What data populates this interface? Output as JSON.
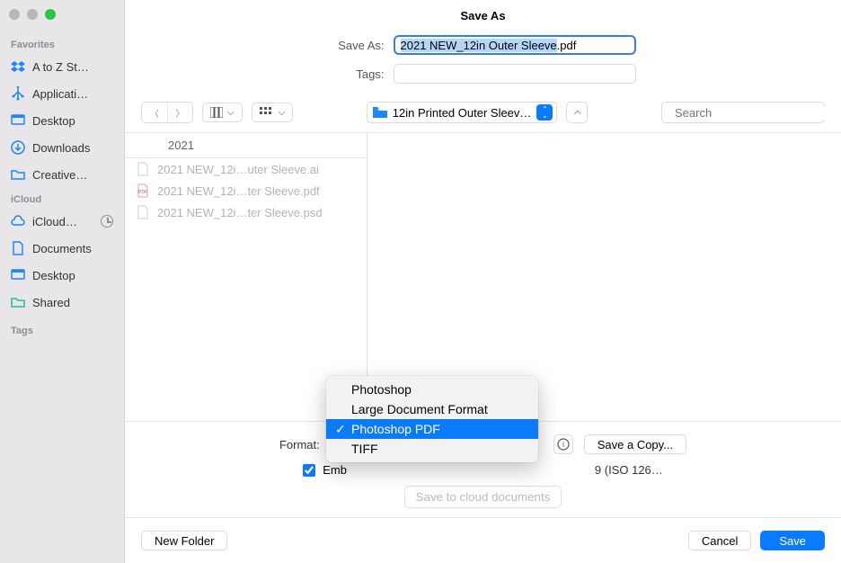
{
  "window": {
    "title": "Save As"
  },
  "form": {
    "save_as_label": "Save As:",
    "filename": "2021 NEW_12in Outer Sleeve.pdf",
    "tags_label": "Tags:"
  },
  "sidebar": {
    "favorites_label": "Favorites",
    "icloud_label": "iCloud",
    "tags_label": "Tags",
    "favorites": [
      {
        "label": "A to Z St…",
        "icon": "dropbox"
      },
      {
        "label": "Applicati…",
        "icon": "app"
      },
      {
        "label": "Desktop",
        "icon": "desktop"
      },
      {
        "label": "Downloads",
        "icon": "download"
      },
      {
        "label": "Creative…",
        "icon": "folder"
      }
    ],
    "icloud": [
      {
        "label": "iCloud… ",
        "icon": "cloud",
        "has_time": true
      },
      {
        "label": "Documents",
        "icon": "document"
      },
      {
        "label": "Desktop",
        "icon": "desktop"
      },
      {
        "label": "Shared",
        "icon": "shared"
      }
    ]
  },
  "toolbar": {
    "path": "12in Printed Outer Sleev…",
    "search_placeholder": "Search"
  },
  "browser": {
    "col1_header": "2021",
    "files": [
      {
        "name": "2021 NEW_12i…uter Sleeve.ai",
        "kind": "ai"
      },
      {
        "name": "2021 NEW_12i…ter Sleeve.pdf",
        "kind": "pdf"
      },
      {
        "name": "2021 NEW_12i…ter Sleeve.psd",
        "kind": "psd"
      }
    ]
  },
  "format": {
    "label": "Format:",
    "menu": [
      "Photoshop",
      "Large Document Format",
      "Photoshop PDF",
      "TIFF"
    ],
    "selected_index": 2,
    "save_copy_label": "Save a Copy..."
  },
  "embed": {
    "prefix": "Emb",
    "suffix": "9 (ISO 126…"
  },
  "cloud_button": "Save to cloud documents",
  "actions": {
    "new_folder": "New Folder",
    "cancel": "Cancel",
    "save": "Save"
  }
}
